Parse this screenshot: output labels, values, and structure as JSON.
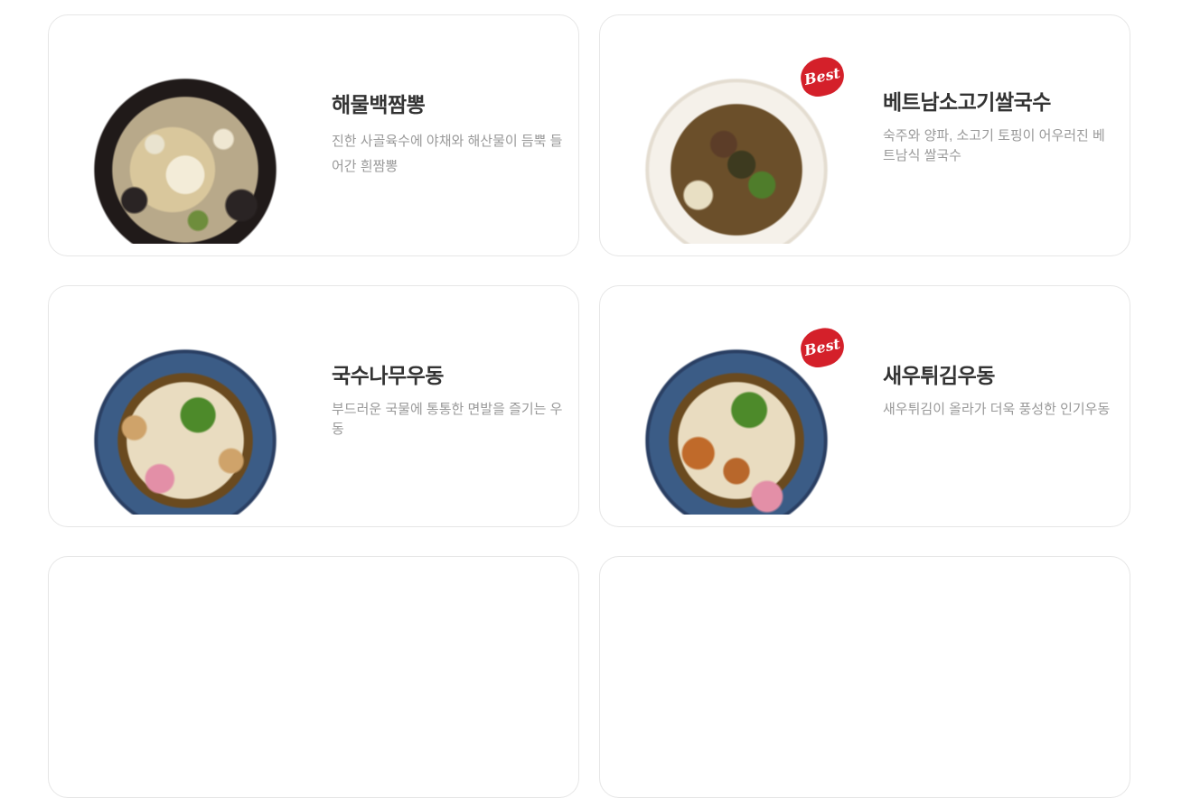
{
  "menu": {
    "items": [
      {
        "title": "해물백짬뽕",
        "description": "진한 사골육수에 야채와 해산물이 듬뿍 들어간 흰짬뽕",
        "badge": "",
        "bowl_color": "#201a19"
      },
      {
        "title": "베트남소고기쌀국수",
        "description": "숙주와 양파, 소고기 토핑이 어우러진 베트남식 쌀국수",
        "badge": "Best",
        "bowl_color": "#f5f1ea"
      },
      {
        "title": "국수나무우동",
        "description": "부드러운 국물에 통통한 면발을 즐기는 우동",
        "badge": "",
        "bowl_color": "#3b5c86"
      },
      {
        "title": "새우튀김우동",
        "description": "새우튀김이 올라가 더욱 풍성한 인기우동",
        "badge": "Best",
        "bowl_color": "#3b5c86"
      }
    ]
  },
  "colors": {
    "badge_red": "#d4202a",
    "title_text": "#333333",
    "desc_text": "#999999",
    "card_border": "#e6e6e6"
  }
}
